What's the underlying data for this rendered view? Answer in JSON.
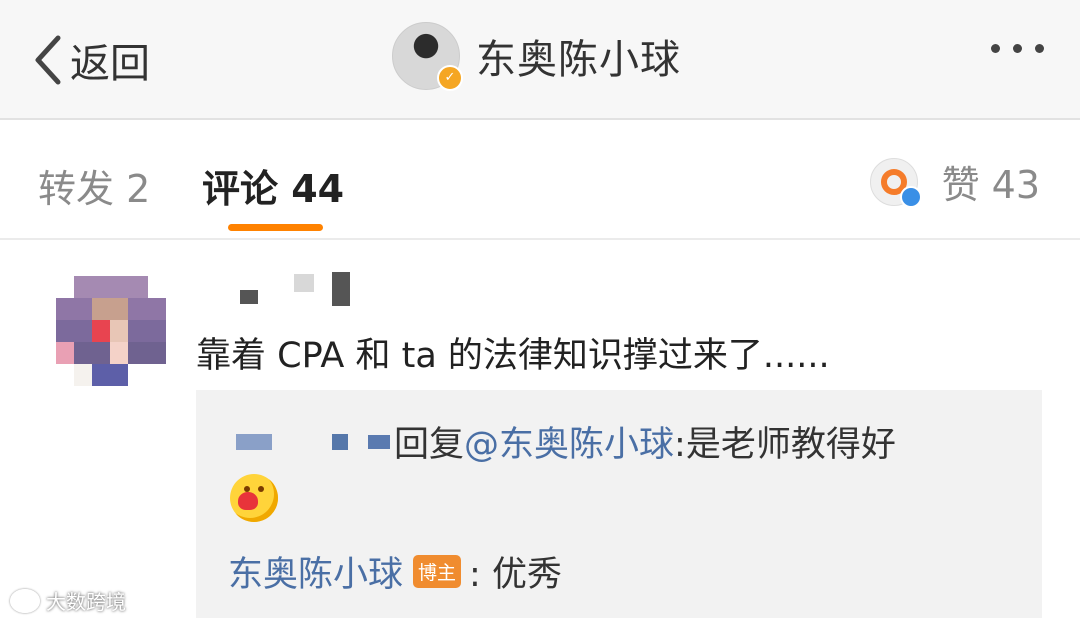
{
  "header": {
    "back_label": "返回",
    "title": "东奥陈小球",
    "back_icon": "chevron-left-icon",
    "more_icon": "more-dots-icon"
  },
  "tabs": {
    "repost": "转发 2",
    "comment": "评论 44",
    "like": "赞 43",
    "active_color": "#ff8200"
  },
  "comment": {
    "text": "靠着 CPA 和 ta 的法律知识撑过来了......",
    "reply": {
      "prefix": "回复 ",
      "mention": "@东奥陈小球",
      "text": ":是老师教得好",
      "emoji": "hug-emoji"
    },
    "author_reply": {
      "author": "东奥陈小球",
      "badge": "博主",
      "text": " : 优秀"
    }
  },
  "watermark": {
    "text": "大数跨境"
  },
  "colors": {
    "link": "#4a6fa5",
    "badge": "#f08c2f",
    "header_bg": "#f7f7f7",
    "reply_bg": "#f2f2f2"
  }
}
